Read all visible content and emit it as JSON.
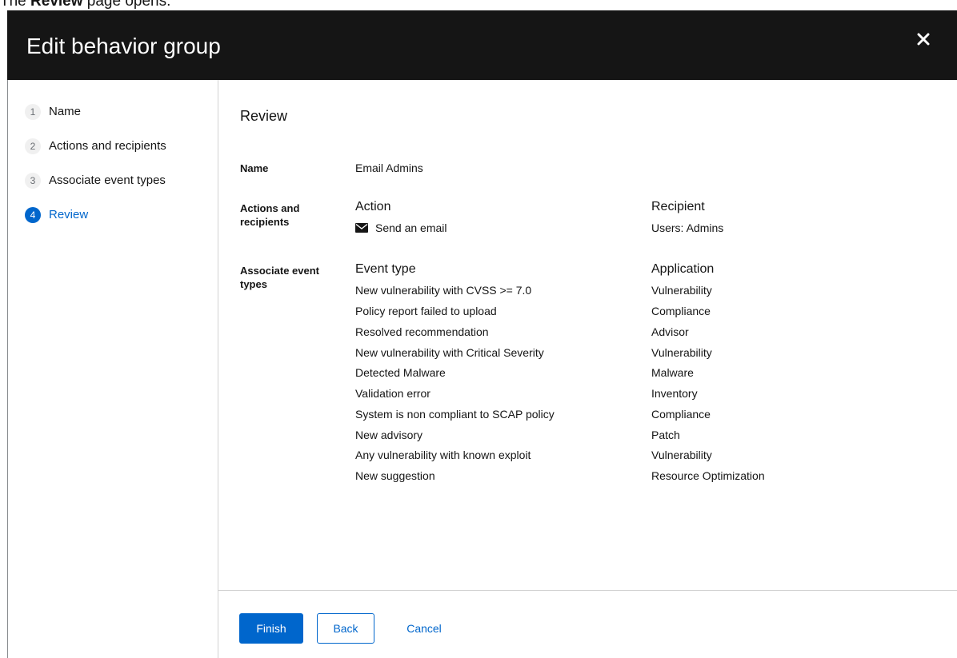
{
  "caption": {
    "prefix": "The ",
    "bold": "Review",
    "suffix": " page opens."
  },
  "modal": {
    "title": "Edit behavior group",
    "close_icon": "close-icon"
  },
  "nav": {
    "items": [
      {
        "number": "1",
        "label": "Name",
        "current": false
      },
      {
        "number": "2",
        "label": "Actions and recipients",
        "current": false
      },
      {
        "number": "3",
        "label": "Associate event types",
        "current": false
      },
      {
        "number": "4",
        "label": "Review",
        "current": true
      }
    ]
  },
  "review": {
    "title": "Review",
    "name_term": "Name",
    "name_value": "Email Admins",
    "actions_term": "Actions and recipients",
    "action_header": "Action",
    "recipient_header": "Recipient",
    "action_icon": "envelope-icon",
    "action_value": "Send an email",
    "recipient_value": "Users: Admins",
    "events_term": "Associate event types",
    "event_type_header": "Event type",
    "application_header": "Application",
    "events": [
      {
        "event": "New vulnerability with CVSS >= 7.0",
        "application": "Vulnerability"
      },
      {
        "event": "Policy report failed to upload",
        "application": "Compliance"
      },
      {
        "event": "Resolved recommendation",
        "application": "Advisor"
      },
      {
        "event": "New vulnerability with Critical Severity",
        "application": "Vulnerability"
      },
      {
        "event": "Detected Malware",
        "application": "Malware"
      },
      {
        "event": "Validation error",
        "application": "Inventory"
      },
      {
        "event": "System is non compliant to SCAP policy",
        "application": "Compliance"
      },
      {
        "event": "New advisory",
        "application": "Patch"
      },
      {
        "event": "Any vulnerability with known exploit",
        "application": "Vulnerability"
      },
      {
        "event": "New suggestion",
        "application": "Resource Optimization"
      }
    ]
  },
  "footer": {
    "finish_label": "Finish",
    "back_label": "Back",
    "cancel_label": "Cancel"
  },
  "colors": {
    "header_bg": "#151515",
    "primary": "#0066cc",
    "text": "#151515"
  }
}
